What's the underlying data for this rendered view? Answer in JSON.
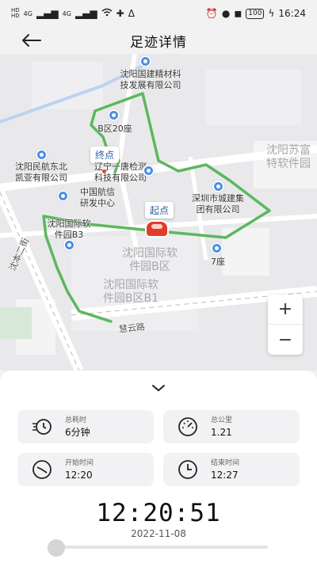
{
  "status_bar": {
    "left_tags": [
      "HD",
      "HD",
      "4G",
      "4G"
    ],
    "battery": "100",
    "time": "16:24"
  },
  "header": {
    "title": "足迹详情"
  },
  "map": {
    "labels": {
      "building_materials": "沈阳国建精材科\n技发展有限公司",
      "b20": "B区20座",
      "minhang": "沈阳民航东北\n凯亚有限公司",
      "liaoning": "辽宁一唐检测\n科技有限公司",
      "hangxin": "中国航信\n研发中心",
      "shenzhen": "深圳市城建集\n团有限公司",
      "suzhou": "沈阳苏富\n特软件园",
      "b3": "沈阳国际软\n件园B3",
      "park_b": "沈阳国际软\n件园B区",
      "b7": "7座",
      "park_b1": "沈阳国际软\n件园B区B1",
      "road_huiyun": "慧云路",
      "road_shenben": "沈本二街"
    },
    "end_tag": "终点",
    "start_tag": "起点",
    "zoom_in": "+",
    "zoom_out": "−",
    "route_color": "#5cb85c"
  },
  "stats": {
    "total_time_label": "总耗时",
    "total_time_value": "6分钟",
    "total_km_label": "总公里",
    "total_km_value": "1.21",
    "start_time_label": "开始时间",
    "start_time_value": "12:20",
    "end_time_label": "结束时间",
    "end_time_value": "12:27"
  },
  "playback": {
    "time": "12:20:51",
    "date": "2022-11-08",
    "progress": 0
  }
}
